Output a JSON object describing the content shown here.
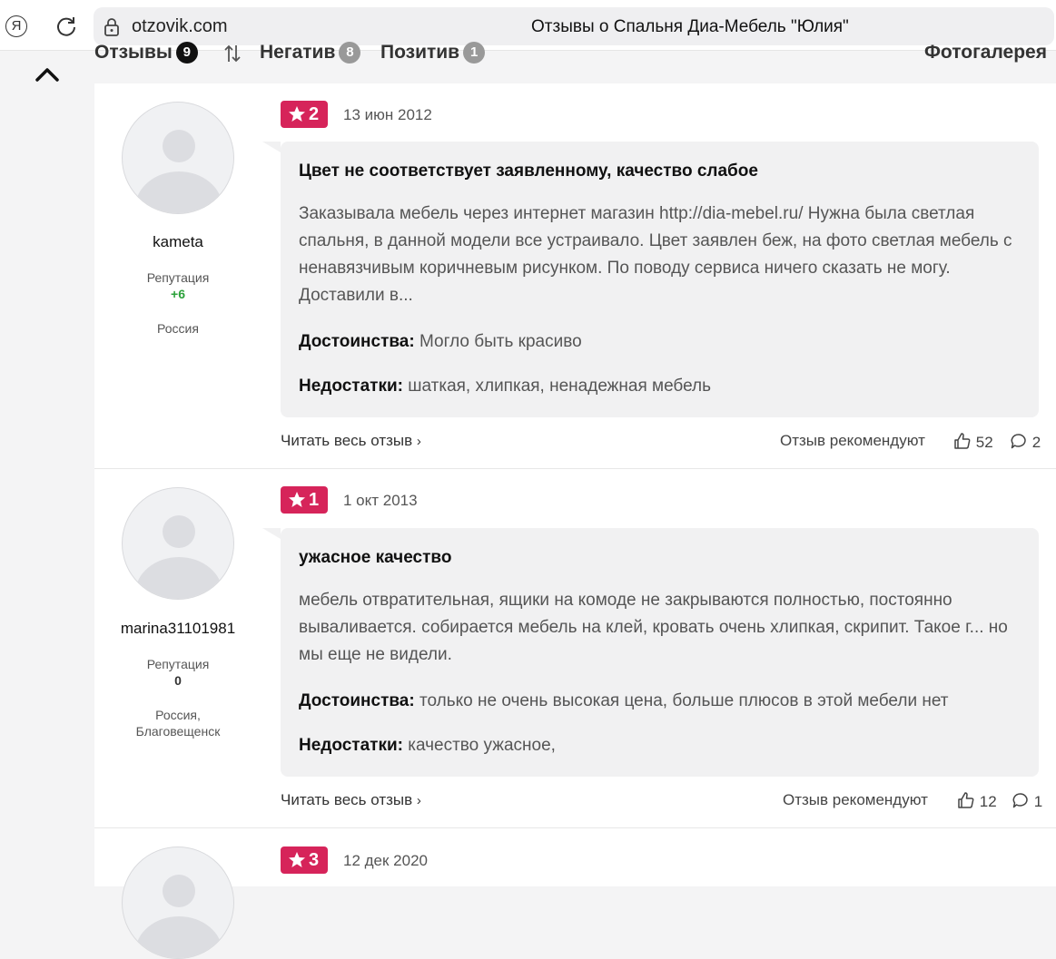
{
  "browser": {
    "domain": "otzovik.com",
    "title": "Отзывы о Спальня Диа-Мебель \"Юлия\""
  },
  "filters": {
    "reviews_label": "Отзывы",
    "reviews_count": "9",
    "negative_label": "Негатив",
    "negative_count": "8",
    "positive_label": "Позитив",
    "positive_count": "1",
    "gallery_label": "Фотогалерея"
  },
  "reviews": [
    {
      "username": "kameta",
      "reputation_label": "Репутация",
      "reputation_value": "+6",
      "location": "Россия",
      "rating": "2",
      "date": "13 июн 2012",
      "title": "Цвет не соответствует заявленному, качество слабое",
      "text": "Заказывала мебель через интернет магазин http://dia-mebel.ru/ Нужна была светлая спальня, в данной модели все устраивало. Цвет заявлен беж, на фото светлая мебель с ненавязчивым коричневым рисунком. По поводу сервиса ничего сказать не могу. Доставили в...",
      "pros_label": "Достоинства:",
      "pros": "Могло быть красиво",
      "cons_label": "Недостатки:",
      "cons": "шаткая, хлипкая, ненадежная мебель",
      "read_more": "Читать весь отзыв",
      "recommend_label": "Отзыв рекомендуют",
      "likes": "52",
      "comments": "2"
    },
    {
      "username": "marina31101981",
      "reputation_label": "Репутация",
      "reputation_value": "0",
      "location_line1": "Россия,",
      "location_line2": "Благовещенск",
      "rating": "1",
      "date": "1 окт 2013",
      "title": "ужасное качество",
      "text": "мебель отвратительная, ящики на комоде не закрываются полностью, постоянно вываливается. собирается мебель на клей, кровать очень хлипкая, скрипит. Такое г... но мы еще не видели.",
      "pros_label": "Достоинства:",
      "pros": "только не очень высокая цена, больше плюсов в этой мебели нет",
      "cons_label": "Недостатки:",
      "cons": "качество ужасное,",
      "read_more": "Читать весь отзыв",
      "recommend_label": "Отзыв рекомендуют",
      "likes": "12",
      "comments": "1"
    },
    {
      "rating": "3",
      "date": "12 дек 2020"
    }
  ]
}
